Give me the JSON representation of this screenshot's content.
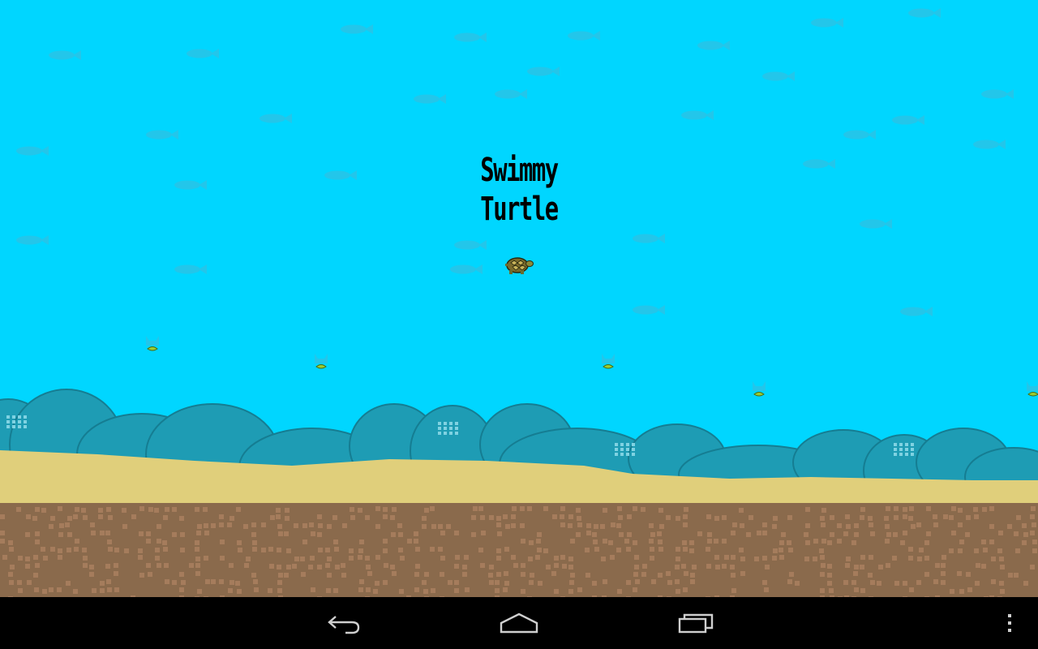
{
  "game": {
    "title": "Swimmy Turtle",
    "colors": {
      "water": "#00d6ff",
      "ghost_fish": "#23c6ea",
      "hills": "#1e9cb4",
      "hills_outline": "#157d92",
      "sand": "#e0cf7b",
      "dirt": "#8a6a4c",
      "dirt_speckle": "#a57c5c",
      "food": "#9acd32"
    },
    "player_icon": "turtle-icon",
    "food_icon": "fish-food-icon"
  },
  "navbar": {
    "background": "#000000",
    "icons": [
      "back-icon",
      "home-icon",
      "recent-apps-icon",
      "overflow-menu-icon"
    ]
  }
}
